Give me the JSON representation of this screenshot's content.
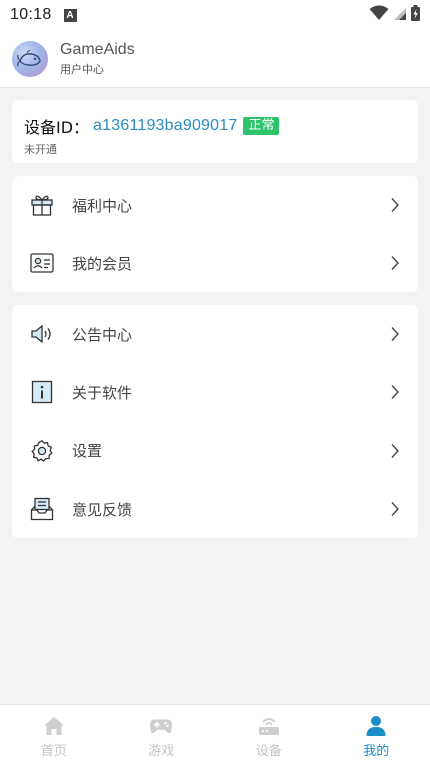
{
  "status_bar": {
    "time": "10:18",
    "notification_icon": "a-badge-icon",
    "icons": [
      "wifi-icon",
      "signal-icon",
      "battery-charging-icon"
    ]
  },
  "header": {
    "title": "GameAids",
    "subtitle": "用户中心",
    "avatar_icon": "whale-avatar-icon"
  },
  "device": {
    "label": "设备ID：",
    "id": "a1361193ba909017",
    "badge": "正常",
    "status": "未开通",
    "badge_color": "#2ec26a",
    "id_color": "#2a8bc1"
  },
  "menu_group1": [
    {
      "label": "福利中心",
      "icon": "gift-icon"
    },
    {
      "label": "我的会员",
      "icon": "member-card-icon"
    }
  ],
  "menu_group2": [
    {
      "label": "公告中心",
      "icon": "speaker-icon"
    },
    {
      "label": "关于软件",
      "icon": "info-icon"
    },
    {
      "label": "设置",
      "icon": "gear-icon"
    },
    {
      "label": "意见反馈",
      "icon": "feedback-inbox-icon"
    }
  ],
  "tabs": [
    {
      "label": "首页",
      "icon": "home-icon",
      "active": false
    },
    {
      "label": "游戏",
      "icon": "gamepad-icon",
      "active": false
    },
    {
      "label": "设备",
      "icon": "router-icon",
      "active": false
    },
    {
      "label": "我的",
      "icon": "user-icon",
      "active": true
    }
  ],
  "colors": {
    "accent": "#1b8ec9",
    "inactive_tab": "#c4c4c4",
    "background": "#f3f3f3"
  }
}
